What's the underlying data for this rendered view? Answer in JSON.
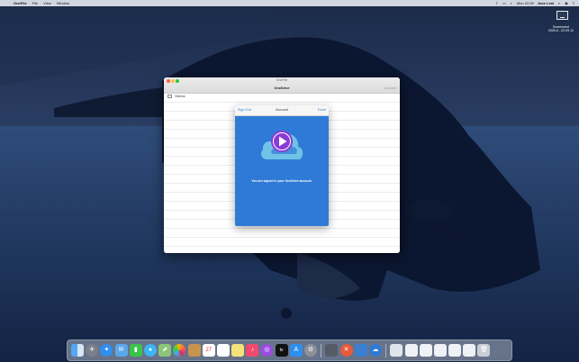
{
  "menubar": {
    "apple": "",
    "app_name": "OneFile",
    "menus": [
      "File",
      "View",
      "Window"
    ],
    "clock": "Mon 22:09",
    "user": "Jose Leal",
    "status_icons": [
      "bluetooth-icon",
      "display-icon",
      "volume-icon",
      "search-icon",
      "siri-icon",
      "control-center-icon"
    ]
  },
  "desktop_shortcut": {
    "label_line1": "Screenshot",
    "label_line2": "2020-0...22.09.12"
  },
  "window": {
    "small_title": "OneFile",
    "header_title": "OneDrive",
    "account_label": "Account",
    "rows": [
      {
        "label": "Videos",
        "icon": "folder-icon"
      }
    ]
  },
  "sheet": {
    "sign_out": "Sign Out",
    "title": "Account",
    "done": "Done",
    "message": "You are signed in your OneDrive account."
  },
  "colors": {
    "accent": "#2f7ad6",
    "play_purple": "#8a3ad6",
    "cloud": "#6ec3e6"
  },
  "dock": {
    "apps": [
      "finder-icon",
      "launchpad-icon",
      "safari-icon",
      "mail-icon",
      "facetime-icon",
      "messages-icon",
      "maps-icon",
      "photos-icon",
      "contacts-icon",
      "calendar-icon",
      "reminders-icon",
      "notes-icon",
      "music-icon",
      "podcasts-icon",
      "tv-icon",
      "app-store-icon",
      "system-preferences-icon",
      "terminal-icon",
      "xcode-icon",
      "preview-icon",
      "onefile-icon"
    ],
    "others": [
      "folder-icon",
      "window-icon",
      "window-icon",
      "window-icon",
      "window-icon",
      "window-icon",
      "trash-icon"
    ],
    "tv_label": "tv",
    "calendar_day": "27"
  }
}
